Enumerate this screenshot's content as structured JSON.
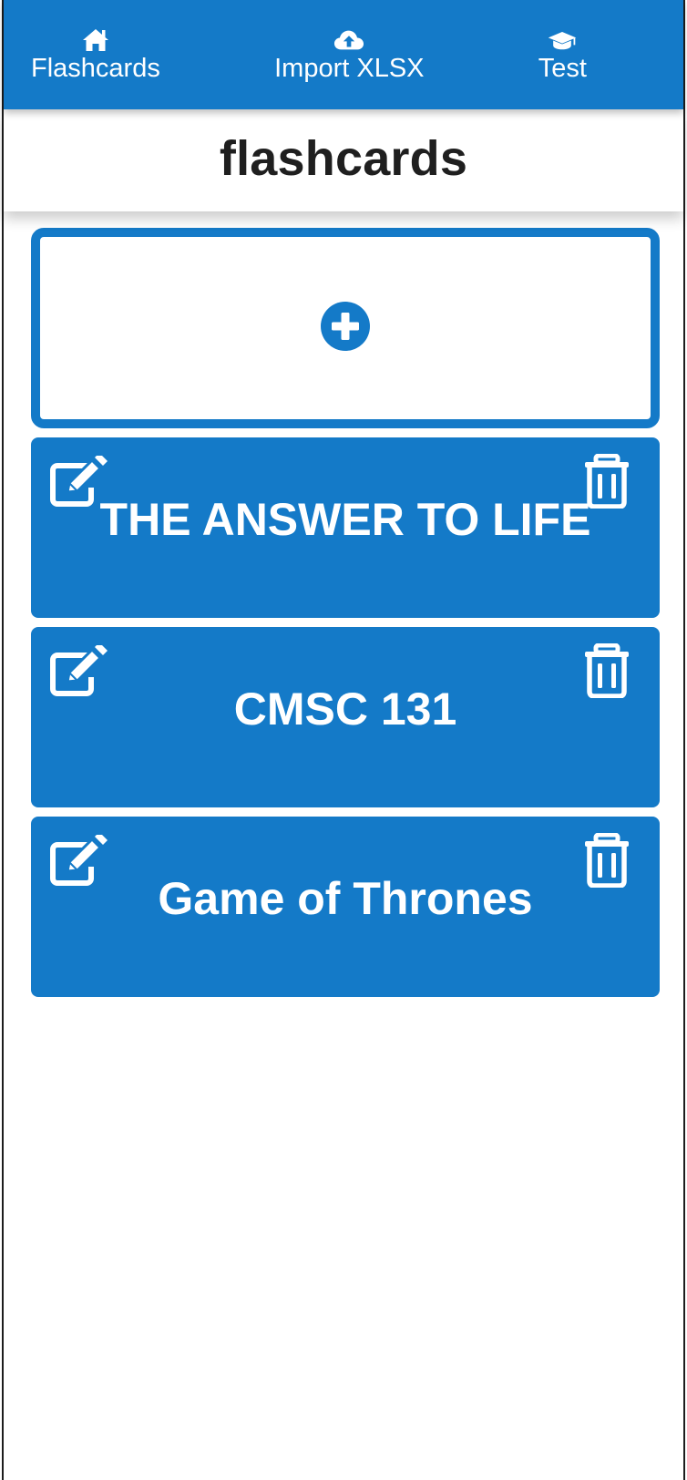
{
  "nav": {
    "items": [
      {
        "label": "Flashcards",
        "icon": "home-icon"
      },
      {
        "label": "Import XLSX",
        "icon": "cloud-upload-icon"
      },
      {
        "label": "Test",
        "icon": "graduation-cap-icon"
      }
    ]
  },
  "page": {
    "title": "flashcards"
  },
  "add_card": {
    "icon": "plus-circle-icon"
  },
  "decks": [
    {
      "title": "THE ANSWER TO LIFE",
      "edit_icon": "edit-icon",
      "delete_icon": "trash-icon"
    },
    {
      "title": "CMSC 131",
      "edit_icon": "edit-icon",
      "delete_icon": "trash-icon"
    },
    {
      "title": "Game of Thrones",
      "edit_icon": "edit-icon",
      "delete_icon": "trash-icon"
    }
  ],
  "colors": {
    "primary": "#147ac8",
    "title_text": "#1f1f1f",
    "background": "#ffffff"
  }
}
